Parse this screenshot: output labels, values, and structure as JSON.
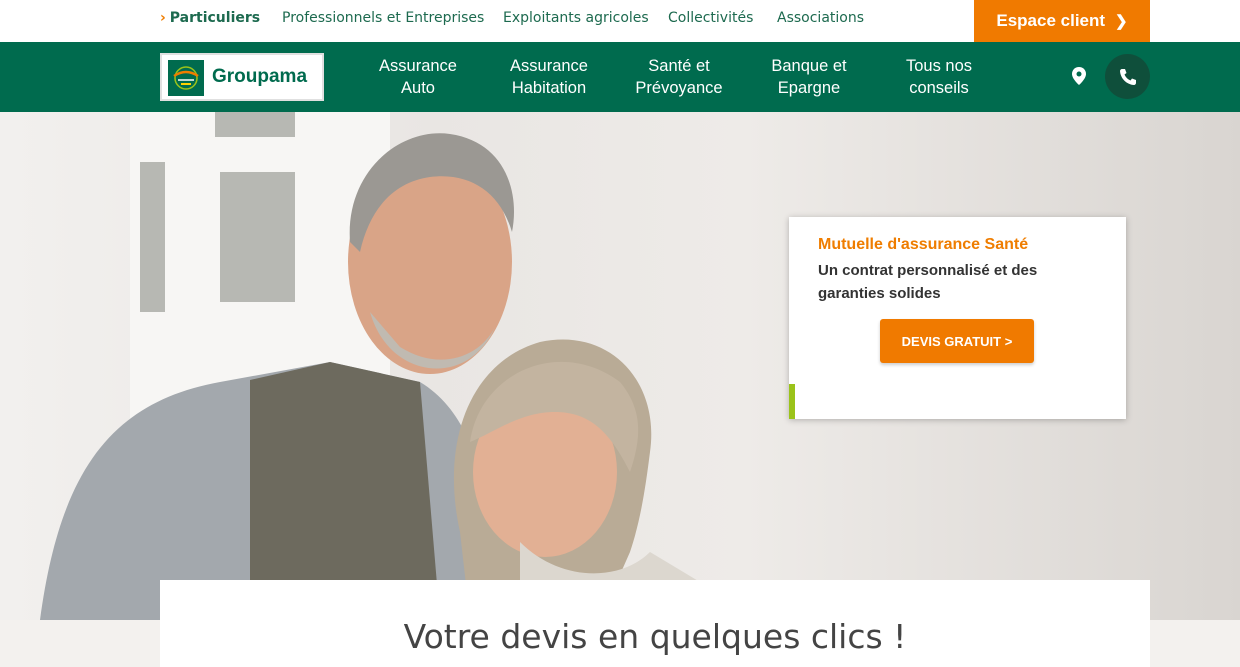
{
  "topnav": {
    "items": [
      "Particuliers",
      "Professionnels et Entreprises",
      "Exploitants agricoles",
      "Collectivités",
      "Associations"
    ],
    "client_button": "Espace client"
  },
  "brand": {
    "name": "Groupama"
  },
  "mainnav": {
    "items": [
      {
        "line1": "Assurance",
        "line2": "Auto"
      },
      {
        "line1": "Assurance",
        "line2": "Habitation"
      },
      {
        "line1": "Santé et",
        "line2": "Prévoyance"
      },
      {
        "line1": "Banque et",
        "line2": "Epargne"
      },
      {
        "line1": "Tous nos",
        "line2": "conseils"
      }
    ],
    "icons": [
      "location-pin-icon",
      "phone-icon"
    ]
  },
  "promo": {
    "title": "Mutuelle d'assurance Santé",
    "text": "Un contrat personnalisé et des garanties solides",
    "button": "DEVIS GRATUIT >"
  },
  "quote": {
    "heading": "Votre devis en quelques clics !"
  },
  "colors": {
    "green": "#006b4e",
    "orange": "#f07a00",
    "lime": "#9bc31a"
  }
}
